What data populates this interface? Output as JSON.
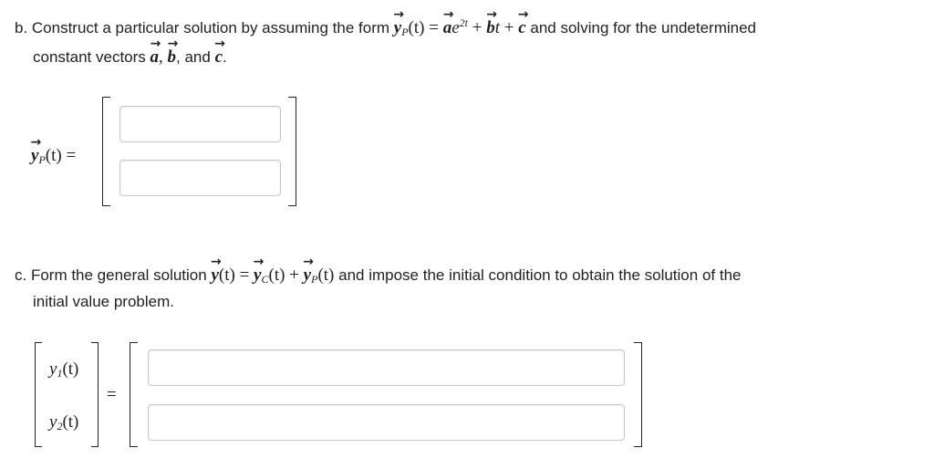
{
  "part_b": {
    "text_1": "b. Construct a particular solution by assuming the form",
    "form_lhs_var": "y",
    "form_lhs_sub": "P",
    "form_lhs_arg": "(t) =",
    "form_a": "a",
    "form_exp_base": "e",
    "form_exp": "2t",
    "form_plus_1": "+",
    "form_b": "b",
    "form_t": "t",
    "form_plus_2": "+",
    "form_c": "c",
    "text_2": "and solving for the undetermined",
    "text_3": "constant vectors",
    "vec_a": "a",
    "comma": ",",
    "vec_b": "b",
    "text_and": ", and",
    "vec_c": "c",
    "period": ".",
    "lhs_var": "y",
    "lhs_sub": "P",
    "lhs_arg": "(t) ="
  },
  "part_c": {
    "text_1": "c. Form the general solution",
    "y_var": "y",
    "y_arg": "(t) =",
    "yc_var": "y",
    "yc_sub": "C",
    "yc_arg": "(t) +",
    "yp_var": "y",
    "yp_sub": "P",
    "yp_arg": "(t)",
    "text_2": "and impose the initial condition to obtain the solution of the",
    "text_3": "initial value problem.",
    "y1_var": "y",
    "y1_sub": "1",
    "y1_arg": "(t)",
    "y2_var": "y",
    "y2_sub": "2",
    "y2_arg": "(t)",
    "equals": "="
  },
  "inputs": {
    "yp_row1": "",
    "yp_row2": "",
    "sol_row1": "",
    "sol_row2": ""
  }
}
